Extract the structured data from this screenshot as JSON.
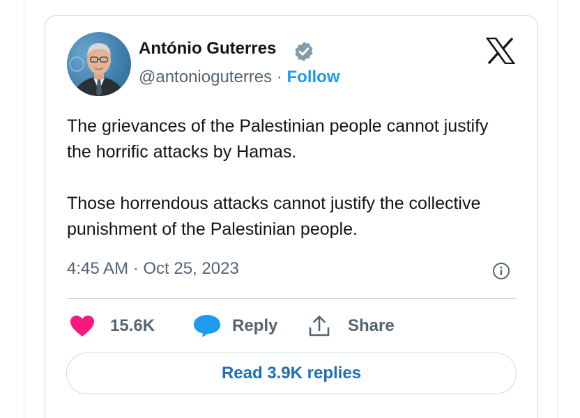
{
  "author": {
    "name": "António Guterres",
    "handle": "@antonioguterres",
    "separator": "·",
    "follow_label": "Follow"
  },
  "tweet": {
    "paragraphs": [
      "The grievances of the Palestinian people cannot justify the horrific attacks by Hamas.",
      "Those horrendous attacks cannot justify the collective punishment of the Palestinian people."
    ],
    "timestamp": "4:45 AM · Oct 25, 2023"
  },
  "actions": {
    "likes": "15.6K",
    "reply_label": "Reply",
    "share_label": "Share"
  },
  "footer": {
    "read_replies_label": "Read 3.9K replies"
  },
  "icons": {
    "verified": "verified-badge-icon",
    "platform": "x-logo-icon",
    "info": "info-icon",
    "like": "heart-icon",
    "reply": "speech-bubble-icon",
    "share": "share-upload-icon"
  },
  "colors": {
    "like": "#f91880",
    "reply": "#1d9bf0",
    "follow": "#1d9bf0",
    "read_replies": "#1d6fb8",
    "verified_badge": "#829aab"
  }
}
